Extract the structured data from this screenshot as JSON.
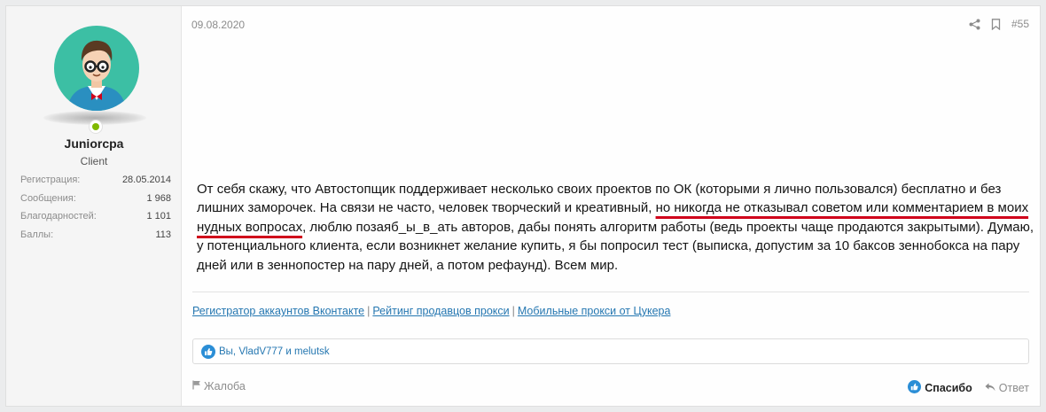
{
  "user": {
    "name": "Juniorcpa",
    "title": "Client",
    "stats": [
      {
        "label": "Регистрация:",
        "value": "28.05.2014"
      },
      {
        "label": "Сообщения:",
        "value": "1 968"
      },
      {
        "label": "Благодарностей:",
        "value": "1 101"
      },
      {
        "label": "Баллы:",
        "value": "113"
      }
    ]
  },
  "post": {
    "date": "09.08.2020",
    "number": "#55",
    "text_1": "От себя скажу, что Автостопщик поддерживает несколько своих проектов по ОК (которыми я лично пользовался) бесплатно и без лишних заморочек. На связи не часто, человек творческий и креативный, ",
    "text_highlight": "но никогда не отказывал советом или комментарием в моих нудных вопросах",
    "text_2": ", люблю позаяб_ы_в_ать авторов, дабы понять алгоритм работы (ведь проекты чаще продаются закрытыми). Думаю, у потенциального клиента, если возникнет желание купить, я бы попросил тест (выписка, допустим за 10 баксов зеннобокса на пару дней или в зеннопостер на пару дней, а потом рефаунд). Всем мир."
  },
  "signature": {
    "links": [
      "Регистратор аккаунтов Вконтакте",
      "Рейтинг продавцов прокси",
      "Мобильные прокси от Цукера"
    ],
    "separator": "|"
  },
  "reactions": {
    "text": "Вы, VladV777 и melutsk"
  },
  "footer": {
    "report": "Жалоба",
    "thanks": "Спасибо",
    "reply": "Ответ"
  },
  "colors": {
    "accent": "#2577b1",
    "underline": "#d0021b",
    "online": "#7fb900",
    "avatar_bg": "#3cbfa4"
  },
  "icons": [
    "share-icon",
    "bookmark-icon",
    "like-icon",
    "flag-icon",
    "reply-icon"
  ]
}
